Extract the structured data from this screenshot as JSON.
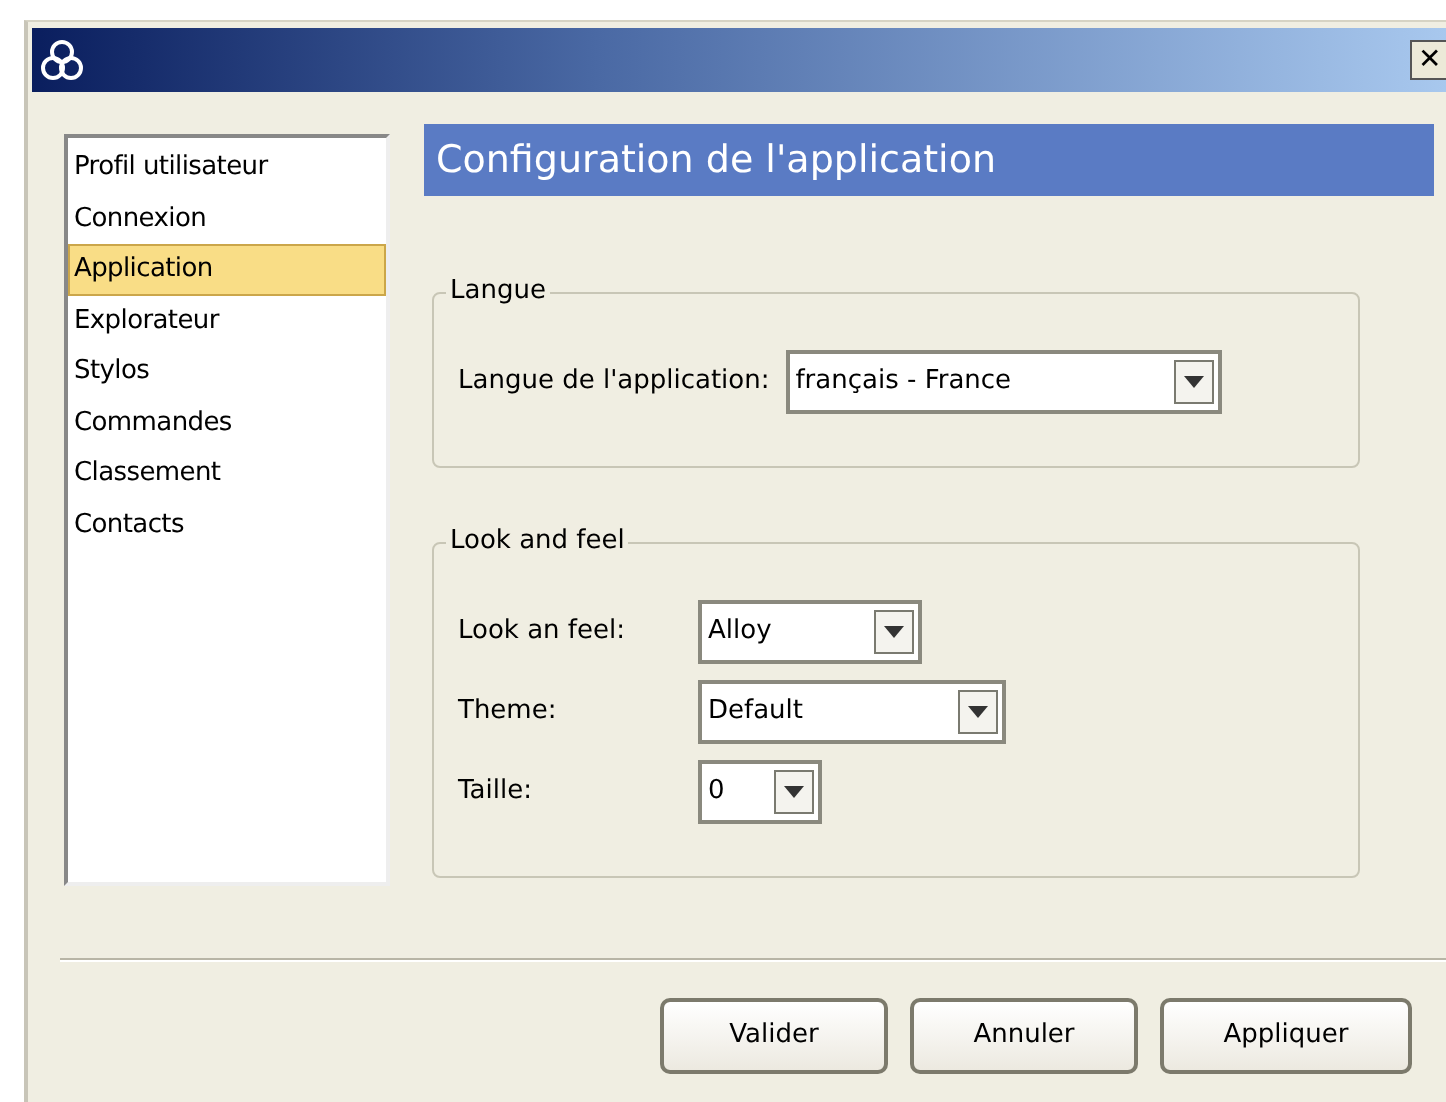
{
  "window": {
    "close": "✕"
  },
  "sidebar": {
    "items": [
      {
        "label": "Profil utilisateur",
        "selected": false
      },
      {
        "label": "Connexion",
        "selected": false
      },
      {
        "label": "Application",
        "selected": true
      },
      {
        "label": "Explorateur",
        "selected": false
      },
      {
        "label": "Stylos",
        "selected": false
      },
      {
        "label": "Commandes",
        "selected": false
      },
      {
        "label": "Classement",
        "selected": false
      },
      {
        "label": "Contacts",
        "selected": false
      }
    ]
  },
  "header": "Configuration de l'application",
  "groups": [
    {
      "title": "Langue",
      "fields": [
        {
          "label": "Langue de l'application:",
          "value": "français - France"
        }
      ]
    },
    {
      "title": "Look and feel",
      "fields": [
        {
          "label": "Look an feel:",
          "value": "Alloy"
        },
        {
          "label": "Theme:",
          "value": "Default"
        },
        {
          "label": "Taille:",
          "value": "0"
        }
      ]
    }
  ],
  "buttons": [
    "Valider",
    "Annuler",
    "Appliquer"
  ]
}
